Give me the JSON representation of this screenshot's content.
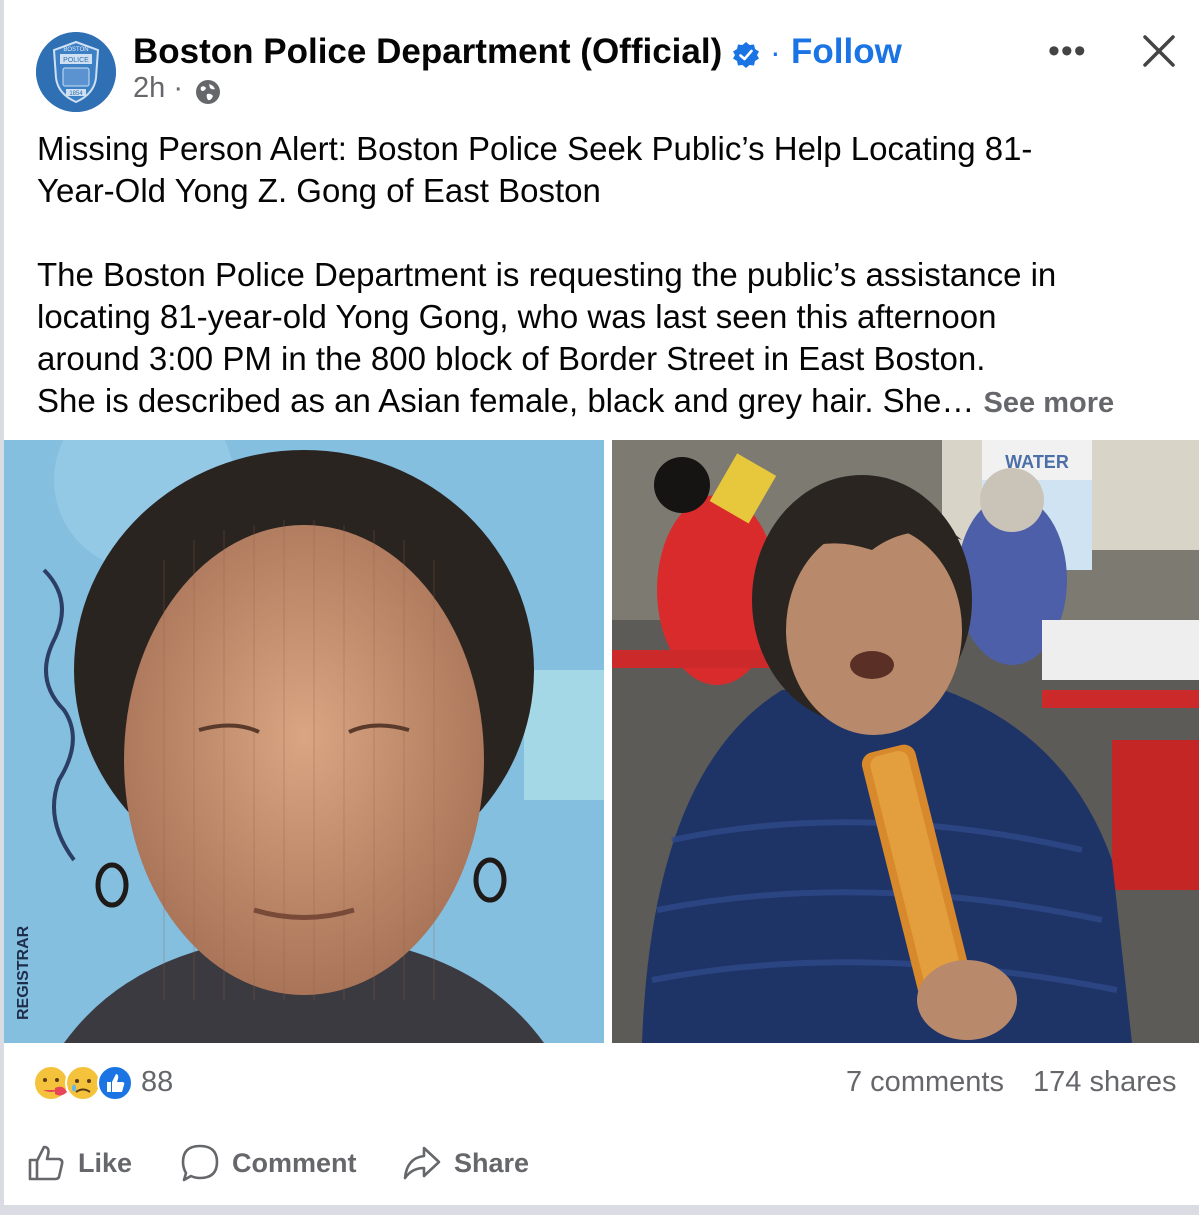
{
  "post": {
    "page_name": "Boston Police Department (Official)",
    "follow_label": "Follow",
    "separator": "·",
    "time": "2h ·",
    "privacy_icon": "globe-icon",
    "badge_text": [
      "BOSTON",
      "POLICE",
      "1854"
    ],
    "text_line1": "Missing Person Alert: Boston Police Seek Public’s Help Locating 81-",
    "text_line2": "Year-Old Yong Z. Gong of East Boston",
    "body_line1": "The Boston Police Department is requesting the public’s assistance in",
    "body_line2": "locating 81-year-old Yong Gong, who was last seen this afternoon",
    "body_line3": "around 3:00 PM in the 800 block of Border Street in East Boston.",
    "body_line4": "She is described as an Asian female, black and grey hair. She…",
    "see_more": "See more"
  },
  "images": {
    "left_text": "REGISTRAR",
    "right_text": "WATER"
  },
  "stats": {
    "reaction_count": "88",
    "comments": "7 comments",
    "shares": "174 shares",
    "reaction_icons": [
      "care-icon",
      "sad-icon",
      "like-icon"
    ]
  },
  "actions": {
    "like": "Like",
    "comment": "Comment",
    "share": "Share"
  },
  "colors": {
    "accent": "#1b74e4",
    "secondary_text": "#65676b"
  }
}
